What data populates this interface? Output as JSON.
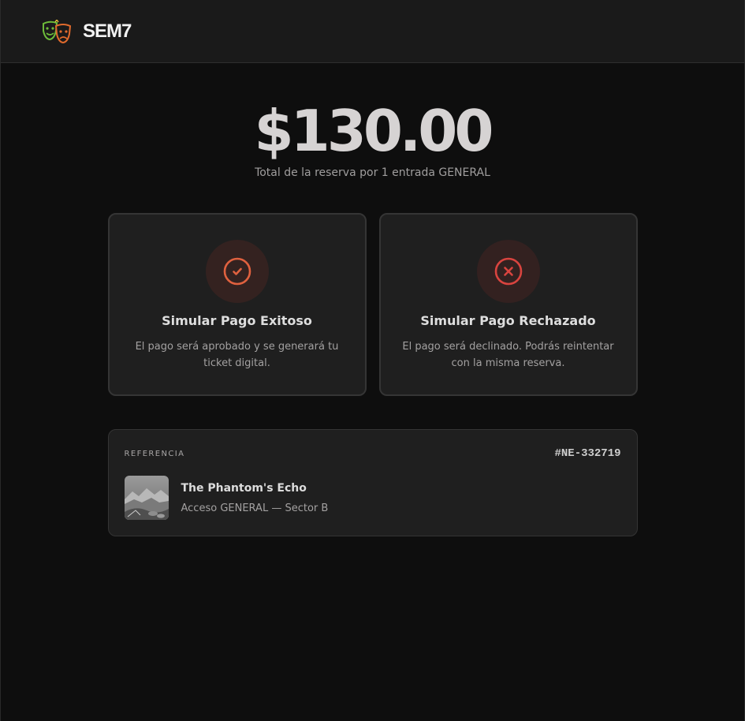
{
  "header": {
    "brand_name": "SEM7",
    "logo_icon": "theater-masks-icon"
  },
  "summary": {
    "amount": "$130.00",
    "description": "Total de la reserva por 1 entrada GENERAL"
  },
  "options": [
    {
      "icon": "check-circle-icon",
      "title": "Simular Pago Exitoso",
      "description": "El pago será aprobado y se generará tu ticket digital."
    },
    {
      "icon": "x-circle-icon",
      "title": "Simular Pago Rechazado",
      "description": "El pago será declinado. Podrás reintentar con la misma reserva."
    }
  ],
  "reference": {
    "label": "REFERENCIA",
    "code": "#NE-332719",
    "event_title": "The Phantom's Echo",
    "event_access": "Acceso GENERAL — Sector B",
    "thumbnail_icon": "event-thumbnail-image"
  },
  "colors": {
    "background": "#0e0e0e",
    "card": "#1f1f1f",
    "success_accent": "#e0613f",
    "fail_accent": "#d9443f"
  }
}
